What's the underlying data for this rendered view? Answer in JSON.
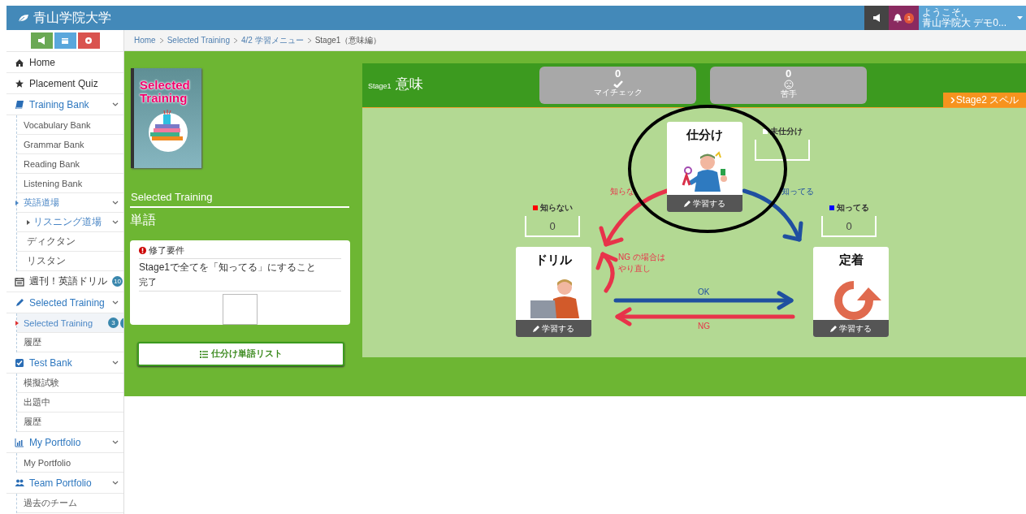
{
  "header": {
    "logo": "青山学院大学",
    "notification_count": "1",
    "welcome": "ようこそ,",
    "user": "青山学院大 デモ0..."
  },
  "sidebar": {
    "tool_buttons": [
      {
        "kind": "announce"
      },
      {
        "kind": "calendar"
      },
      {
        "kind": "settings"
      }
    ],
    "items": [
      {
        "label": "Home",
        "selected": false
      },
      {
        "label": "Placement Quiz",
        "selected": false
      },
      {
        "label": "Training Bank",
        "selected": false,
        "expanded": true,
        "children": [
          {
            "label": "Vocabulary Bank",
            "selected": false
          },
          {
            "label": "Grammar Bank",
            "selected": false
          },
          {
            "label": "Reading Bank",
            "selected": false
          },
          {
            "label": "Listening Bank",
            "selected": false
          },
          {
            "label": "英語道場",
            "selected": false,
            "expanded": true,
            "children": [
              {
                "label": "リスニング道場",
                "selected": false,
                "expanded": true,
                "children": [
                  {
                    "label": "ディクタン",
                    "selected": false
                  },
                  {
                    "label": "リスタン",
                    "selected": false
                  }
                ]
              }
            ]
          }
        ]
      },
      {
        "label": "週刊！英語ドリル",
        "selected": false,
        "badge": "10"
      },
      {
        "label": "Selected Training",
        "selected": false,
        "expanded": true,
        "children": [
          {
            "label": "Selected Training",
            "selected": true,
            "badge": "3"
          },
          {
            "label": "履歴",
            "selected": false
          }
        ]
      },
      {
        "label": "Test Bank",
        "selected": false,
        "expanded": true,
        "children": [
          {
            "label": "模擬試験",
            "selected": false
          },
          {
            "label": "出題中",
            "selected": false
          },
          {
            "label": "履歴",
            "selected": false
          }
        ]
      },
      {
        "label": "My Portfolio",
        "selected": false,
        "expanded": true,
        "children": [
          {
            "label": "My Portfolio",
            "selected": false
          }
        ]
      },
      {
        "label": "Team Portfolio",
        "selected": false,
        "expanded": true,
        "children": [
          {
            "label": "過去のチーム",
            "selected": false
          }
        ]
      }
    ]
  },
  "breadcrumb": [
    "Home",
    "Selected Training",
    "4/2 学習メニュー",
    "Stage1（意味編）"
  ],
  "course": {
    "cover_title": "Selected Training",
    "title": "Selected Training",
    "subtitle": "単語",
    "requirement": {
      "heading": "修了要件",
      "text": "Stage1で全てを「知ってる」にすること",
      "status": "完了"
    },
    "list_button": "仕分け単語リスト"
  },
  "stage": {
    "label": "Stage1",
    "title": "意味",
    "stats": [
      {
        "kind": "check",
        "count": "0",
        "label": "マイチェック"
      },
      {
        "kind": "weak",
        "count": "0",
        "label": "苦手"
      }
    ],
    "next_tab": "Stage2 スペル"
  },
  "diagram": {
    "cards": [
      {
        "kind": "sort",
        "title": "仕分け",
        "button": "学習する"
      },
      {
        "kind": "drill",
        "title": "ドリル",
        "button": "学習する"
      },
      {
        "kind": "fix",
        "title": "定着",
        "button": "学習する"
      }
    ],
    "counters": [
      {
        "kind": "unsorted",
        "label": "未仕分け",
        "color": "#ffffff"
      },
      {
        "kind": "unknown",
        "label": "知らない",
        "count": "0",
        "color": "#ff0000"
      },
      {
        "kind": "known",
        "label": "知ってる",
        "count": "0",
        "color": "#0000ff"
      }
    ],
    "arrows": [
      {
        "kind": "unknown",
        "label": "知らな"
      },
      {
        "kind": "known",
        "label": "知ってる"
      },
      {
        "kind": "retry",
        "lines": [
          "NG の場合は",
          "やり直し"
        ]
      },
      {
        "kind": "ok",
        "label": "OK"
      },
      {
        "kind": "ng",
        "label": "NG"
      }
    ]
  }
}
